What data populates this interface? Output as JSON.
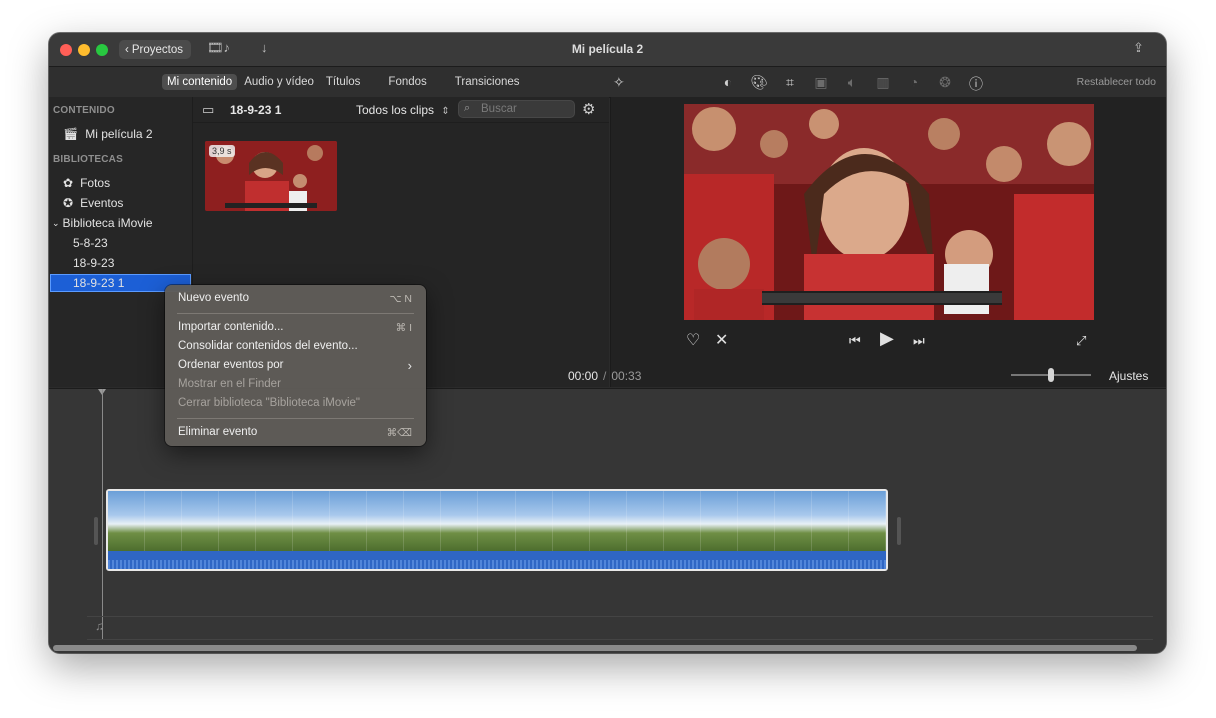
{
  "window": {
    "title": "Mi película 2",
    "back_label": "Proyectos"
  },
  "toolbar": {
    "tabs": [
      "Mi contenido",
      "Audio y vídeo",
      "Títulos",
      "Fondos",
      "Transiciones"
    ],
    "reset_label": "Restablecer todo"
  },
  "sidebar": {
    "content_header": "CONTENIDO",
    "project_item": "Mi película 2",
    "libraries_header": "BIBLIOTECAS",
    "photos_item": "Fotos",
    "events_item": "Eventos",
    "library_item": "Biblioteca iMovie",
    "events": [
      "5-8-23",
      "18-9-23",
      "18-9-23 1"
    ],
    "selected_event": "18-9-23 1"
  },
  "browser": {
    "title": "18-9-23 1",
    "filter": "Todos los clips",
    "search_placeholder": "Buscar",
    "clip_duration": "3,9 s"
  },
  "viewer": {
    "current_time": "00:00",
    "separator": "/",
    "total_time": "00:33",
    "settings_label": "Ajustes"
  },
  "context_menu": {
    "new_event": "Nuevo evento",
    "new_event_shortcut": "⌥ N",
    "import": "Importar contenido...",
    "import_shortcut": "⌘ I",
    "consolidate": "Consolidar contenidos del evento...",
    "sort_events": "Ordenar eventos por",
    "show_finder": "Mostrar en el Finder",
    "close_library": "Cerrar biblioteca \"Biblioteca iMovie\"",
    "delete_event": "Eliminar evento",
    "delete_shortcut": "⌘⌫"
  }
}
